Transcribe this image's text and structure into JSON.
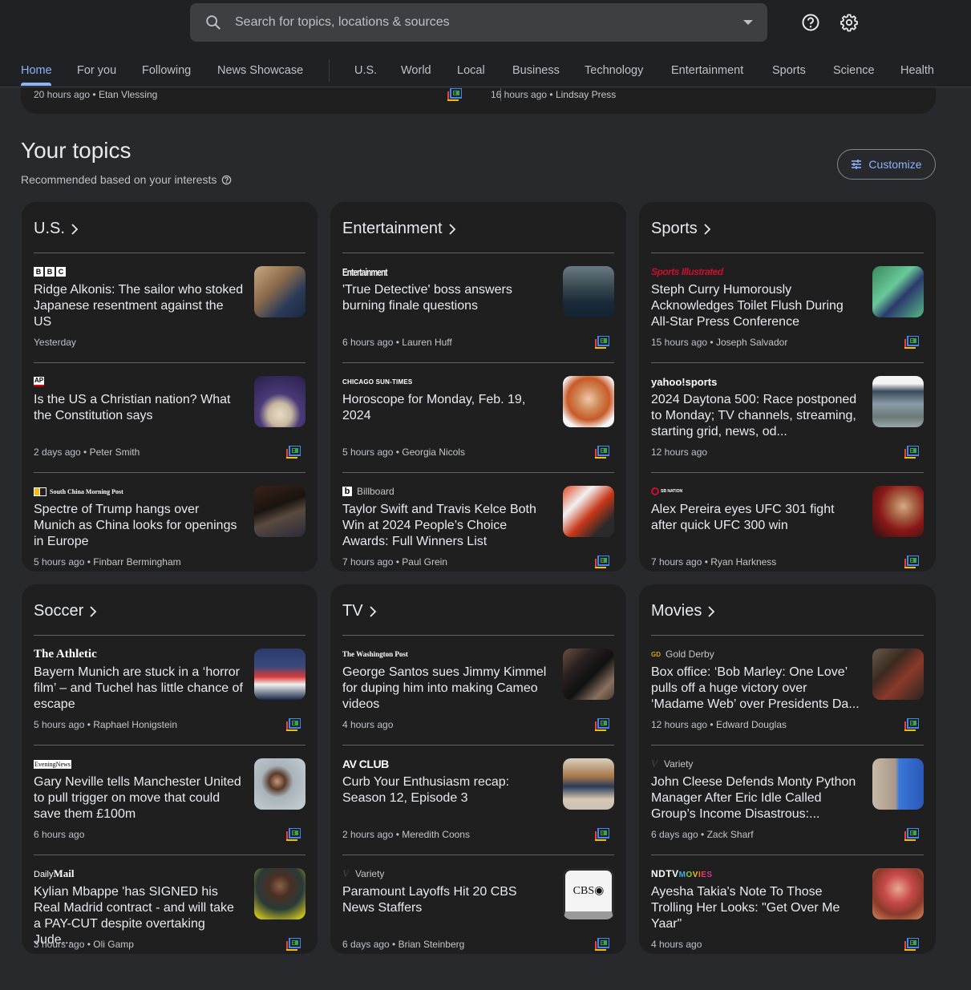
{
  "search": {
    "placeholder": "Search for topics, locations & sources"
  },
  "header_icons": {
    "help": "help-icon",
    "settings": "gear-icon"
  },
  "nav": {
    "tabs": [
      {
        "label": "Home",
        "active": true
      },
      {
        "label": "For you"
      },
      {
        "label": "Following"
      },
      {
        "label": "News Showcase"
      },
      {
        "label": "U.S."
      },
      {
        "label": "World"
      },
      {
        "label": "Local"
      },
      {
        "label": "Business"
      },
      {
        "label": "Technology"
      },
      {
        "label": "Entertainment"
      },
      {
        "label": "Sports"
      },
      {
        "label": "Science"
      },
      {
        "label": "Health"
      }
    ]
  },
  "previous_card": {
    "left_meta_time": "20 hours ago",
    "left_meta_author": "Etan Vlessing",
    "right_meta_time": "16 hours ago",
    "right_meta_author": "Lindsay Press"
  },
  "section": {
    "title": "Your topics",
    "subtitle": "Recommended based on your interests",
    "customize_label": "Customize"
  },
  "topics": [
    {
      "title": "U.S.",
      "stories": [
        {
          "source": "BBC",
          "headline": "Ridge Alkonis: The sailor who stoked Japanese resentment against the US",
          "time": "Yesterday",
          "author": "",
          "full_coverage": false
        },
        {
          "source": "AP",
          "headline": "Is the US a Christian nation? What the Constitution says",
          "time": "2 days ago",
          "author": "Peter Smith",
          "full_coverage": true
        },
        {
          "source": "South China Morning Post",
          "headline": "Spectre of Trump hangs over Munich as China looks for openings in Europe",
          "time": "5 hours ago",
          "author": "Finbarr Bermingham",
          "full_coverage": false
        }
      ]
    },
    {
      "title": "Entertainment",
      "stories": [
        {
          "source": "Entertainment",
          "headline": "'True Detective' boss answers burning finale questions",
          "time": "6 hours ago",
          "author": "Lauren Huff",
          "full_coverage": true
        },
        {
          "source": "CHICAGO SUN-TIMES",
          "headline": "Horoscope for Monday, Feb. 19, 2024",
          "time": "5 hours ago",
          "author": "Georgia Nicols",
          "full_coverage": true
        },
        {
          "source": "Billboard",
          "headline": "Taylor Swift and Travis Kelce Both Win at 2024 People’s Choice Awards: Full Winners List",
          "time": "7 hours ago",
          "author": "Paul Grein",
          "full_coverage": true
        }
      ]
    },
    {
      "title": "Sports",
      "stories": [
        {
          "source": "Sports Illustrated",
          "headline": "Steph Curry Humorously Acknowledges Toilet Flush During All-Star Press Conference",
          "time": "15 hours ago",
          "author": "Joseph Salvador",
          "full_coverage": true
        },
        {
          "source": "yahoo!sports",
          "headline": "2024 Daytona 500: Race postponed to Monday; TV channels, streaming, starting grid, news, od...",
          "time": "12 hours ago",
          "author": "",
          "full_coverage": true
        },
        {
          "source": "SB Nation",
          "headline": "Alex Pereira eyes UFC 301 fight after quick UFC 300 win",
          "time": "7 hours ago",
          "author": "Ryan Harkness",
          "full_coverage": true
        }
      ]
    },
    {
      "title": "Soccer",
      "stories": [
        {
          "source": "The Athletic",
          "headline": "Bayern Munich are stuck in a ‘horror film’ – and Tuchel has little chance of escape",
          "time": "5 hours ago",
          "author": "Raphael Honigstein",
          "full_coverage": true
        },
        {
          "source": "Manchester Evening News",
          "headline": "Gary Neville tells Manchester United to pull trigger on move that could save them £100m",
          "time": "6 hours ago",
          "author": "",
          "full_coverage": true
        },
        {
          "source": "Daily Mail",
          "headline": "Kylian Mbappe 'has SIGNED his Real Madrid contract - and will take a PAY-CUT despite overtaking Jude...",
          "time": "3 hours ago",
          "author": "Oli Gamp",
          "full_coverage": true
        }
      ]
    },
    {
      "title": "TV",
      "stories": [
        {
          "source": "The Washington Post",
          "headline": "George Santos sues Jimmy Kimmel for duping him into making Cameo videos",
          "time": "4 hours ago",
          "author": "",
          "full_coverage": true
        },
        {
          "source": "AV CLUB",
          "headline": "Curb Your Enthusiasm recap: Season 12, Episode 3",
          "time": "2 hours ago",
          "author": "Meredith Coons",
          "full_coverage": true
        },
        {
          "source": "Variety",
          "headline": "Paramount Layoffs Hit 20 CBS News Staffers",
          "time": "6 days ago",
          "author": "Brian Steinberg",
          "full_coverage": true
        }
      ]
    },
    {
      "title": "Movies",
      "stories": [
        {
          "source": "Gold Derby",
          "headline": "Box office: ‘Bob Marley: One Love’ pulls off a huge victory over ‘Madame Web’ over Presidents Da...",
          "time": "12 hours ago",
          "author": "Edward Douglas",
          "full_coverage": true
        },
        {
          "source": "Variety",
          "headline": "John Cleese Defends Monty Python Manager After Eric Idle Called Group’s Income Disastrous:...",
          "time": "6 days ago",
          "author": "Zack Sharf",
          "full_coverage": true
        },
        {
          "source": "NDTV MOVIES",
          "headline": "Ayesha Takia's Note To Those Trolling Her Looks: \"Get Over Me Yaar\"",
          "time": "4 hours ago",
          "author": "",
          "full_coverage": true
        }
      ]
    }
  ],
  "colors": {
    "accent": "#8ab4f8",
    "background": "#28292d",
    "card": "#1f1f20"
  }
}
